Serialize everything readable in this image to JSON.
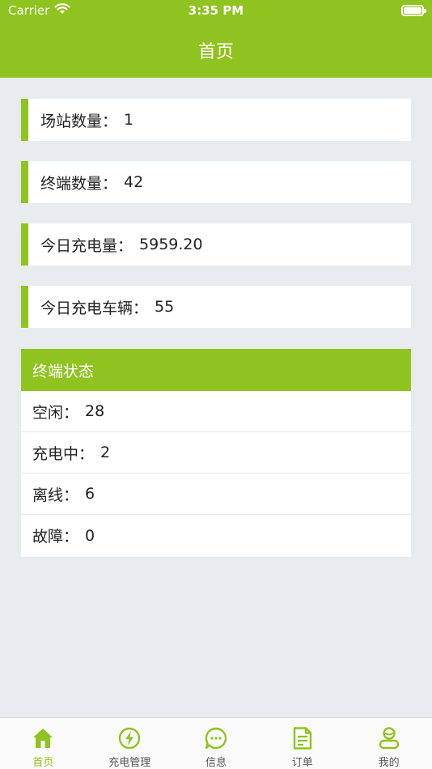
{
  "status_bar": {
    "carrier": "Carrier",
    "time": "3:35 PM"
  },
  "nav": {
    "title": "首页"
  },
  "stats": [
    {
      "label": "场站数量：",
      "value": "1"
    },
    {
      "label": "终端数量：",
      "value": "42"
    },
    {
      "label": "今日充电量：",
      "value": "5959.20"
    },
    {
      "label": "今日充电车辆：",
      "value": "55"
    }
  ],
  "terminal_status": {
    "title": "终端状态",
    "rows": [
      {
        "label": "空闲：",
        "value": "28"
      },
      {
        "label": "充电中：",
        "value": "2"
      },
      {
        "label": "离线：",
        "value": "6"
      },
      {
        "label": "故障：",
        "value": "0"
      }
    ]
  },
  "tabs": [
    {
      "label": "首页",
      "icon": "home-icon",
      "active": true
    },
    {
      "label": "充电管理",
      "icon": "lightning-icon",
      "active": false
    },
    {
      "label": "信息",
      "icon": "message-icon",
      "active": false
    },
    {
      "label": "订单",
      "icon": "document-icon",
      "active": false
    },
    {
      "label": "我的",
      "icon": "user-icon",
      "active": false
    }
  ],
  "colors": {
    "accent": "#8fc31f",
    "background": "#e8ecef"
  }
}
